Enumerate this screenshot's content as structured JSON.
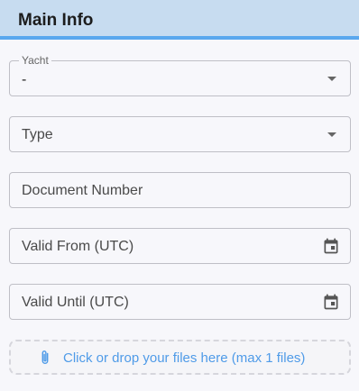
{
  "header": {
    "title": "Main Info"
  },
  "fields": {
    "yacht": {
      "label": "Yacht",
      "value": "-"
    },
    "type": {
      "placeholder": "Type"
    },
    "document_number": {
      "placeholder": "Document Number"
    },
    "valid_from": {
      "placeholder": "Valid From (UTC)"
    },
    "valid_until": {
      "placeholder": "Valid Until (UTC)"
    }
  },
  "upload": {
    "text": "Click or drop your files here (max 1 files)"
  },
  "icons": {
    "dropdown": "caret-down-icon",
    "date": "calendar-icon",
    "attach": "paperclip-icon"
  },
  "colors": {
    "header_bg": "#c7dcf0",
    "header_accent": "#5aa8ee",
    "upload_text": "#4f9be8"
  }
}
